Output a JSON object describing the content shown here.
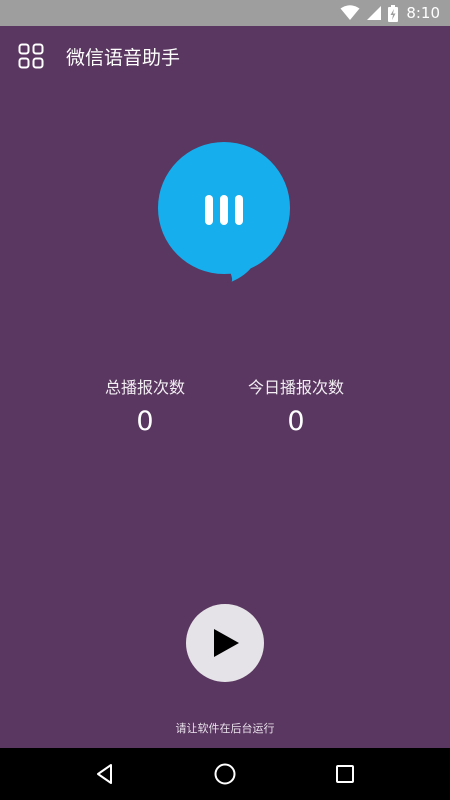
{
  "status_bar": {
    "time": "8:10",
    "icons": [
      "wifi-icon",
      "signal-icon",
      "battery-charging-icon"
    ],
    "background_color": "#9e9e9e"
  },
  "app_bar": {
    "title": "微信语音助手",
    "menu_icon": "grid-menu-icon"
  },
  "voice_bubble": {
    "icon": "voice-bars-icon",
    "color": "#17aeed"
  },
  "stats": {
    "total": {
      "label": "总播报次数",
      "value": "0"
    },
    "today": {
      "label": "今日播报次数",
      "value": "0"
    }
  },
  "controls": {
    "play_icon": "play-icon",
    "hint": "请让软件在后台运行"
  },
  "nav_bar": {
    "back_icon": "back-icon",
    "home_icon": "home-icon",
    "recents_icon": "recents-icon"
  },
  "colors": {
    "background": "#5a3760",
    "accent": "#17aeed",
    "play_button": "#e6e3e8"
  }
}
